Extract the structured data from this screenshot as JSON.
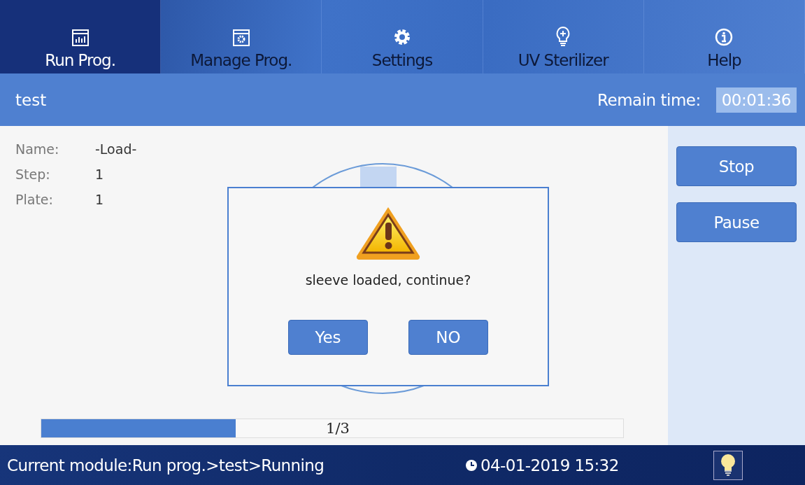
{
  "tabs": [
    {
      "label": "Run Prog.",
      "kind": "chart",
      "selected": true
    },
    {
      "label": "Manage Prog.",
      "kind": "window",
      "selected": false
    },
    {
      "label": "Settings",
      "kind": "gear",
      "selected": false
    },
    {
      "label": "UV Sterilizer",
      "kind": "bulb",
      "selected": false
    },
    {
      "label": "Help",
      "kind": "info",
      "selected": false
    }
  ],
  "program_bar": {
    "name": "test",
    "remain_label": "Remain time:",
    "remain_time": "00:01:36"
  },
  "details": [
    {
      "label": "Name:",
      "value": "-Load-"
    },
    {
      "label": "Step:",
      "value": "1"
    },
    {
      "label": "Plate:",
      "value": "1"
    }
  ],
  "progress": {
    "level": 0.334,
    "text": "1/3"
  },
  "side_buttons": [
    "Stop",
    "Pause"
  ],
  "dialog": {
    "message": "sleeve loaded, continue?",
    "buttons": [
      "Yes",
      "NO"
    ]
  },
  "status_bar": {
    "module": "Current module:Run prog.>test>Running",
    "datetime": "04-01-2019 15:32"
  }
}
